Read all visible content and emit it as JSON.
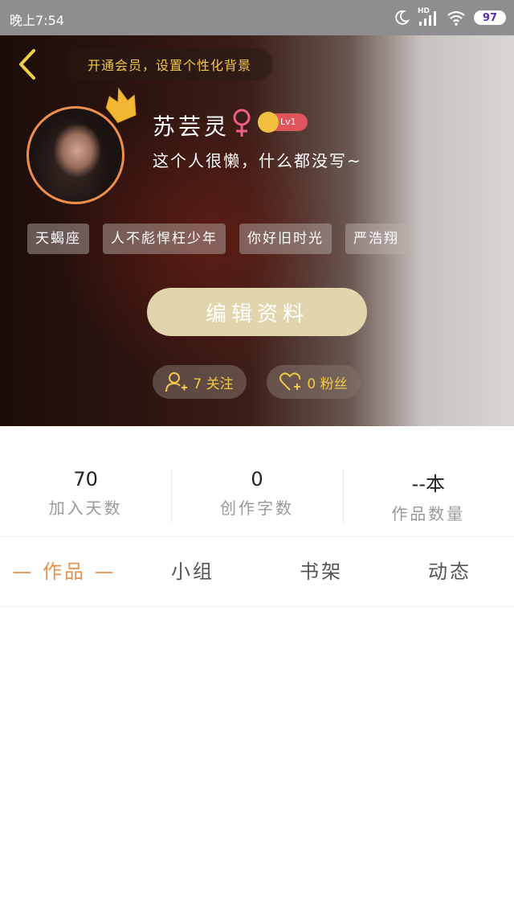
{
  "status_bar": {
    "time": "晚上7:54",
    "battery": "97",
    "network": "HD"
  },
  "header": {
    "vip_banner": "开通会员，设置个性化背景",
    "username": "苏芸灵",
    "level": "Lv1",
    "bio": "这个人很懒，什么都没写~",
    "tags": [
      "天蝎座",
      "人不彪悍枉少年",
      "你好旧时光",
      "严浩翔"
    ],
    "edit_button": "编辑资料",
    "following": "7 关注",
    "followers": "0 粉丝"
  },
  "stats": [
    {
      "value": "70",
      "label": "加入天数"
    },
    {
      "value": "0",
      "label": "创作字数"
    },
    {
      "value": "--本",
      "label": "作品数量"
    }
  ],
  "tabs": [
    "— 作品 —",
    "小组",
    "书架",
    "动态"
  ],
  "colors": {
    "accent": "#e39150",
    "gold": "#f0c94a",
    "edit_button_bg": "#e2d4ad",
    "level_badge": "#e0545e"
  }
}
